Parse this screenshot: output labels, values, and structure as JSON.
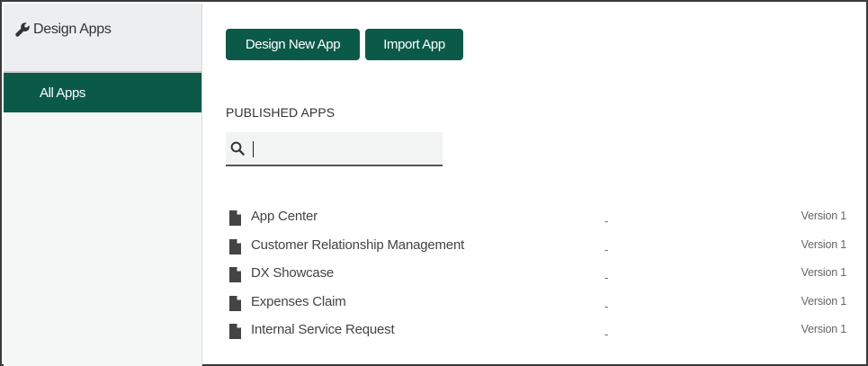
{
  "sidebar": {
    "header": {
      "label": "Design Apps",
      "icon": "wrench-icon"
    },
    "items": [
      {
        "label": "All Apps",
        "active": true
      }
    ]
  },
  "toolbar": {
    "design_new_label": "Design New App",
    "import_label": "Import App"
  },
  "published": {
    "title": "PUBLISHED APPS",
    "search": {
      "value": "",
      "placeholder": ""
    },
    "apps": [
      {
        "name": "App Center",
        "description": "-",
        "version": "Version 1"
      },
      {
        "name": "Customer Relationship Management",
        "description": "-",
        "version": "Version 1"
      },
      {
        "name": "DX Showcase",
        "description": "-",
        "version": "Version 1"
      },
      {
        "name": "Expenses Claim",
        "description": "-",
        "version": "Version 1"
      },
      {
        "name": "Internal Service Request",
        "description": "-",
        "version": "Version 1"
      }
    ]
  },
  "colors": {
    "accent": "#0b5a48",
    "sidebar_bg": "#f5f6f6",
    "header_bg": "#eceeef"
  }
}
